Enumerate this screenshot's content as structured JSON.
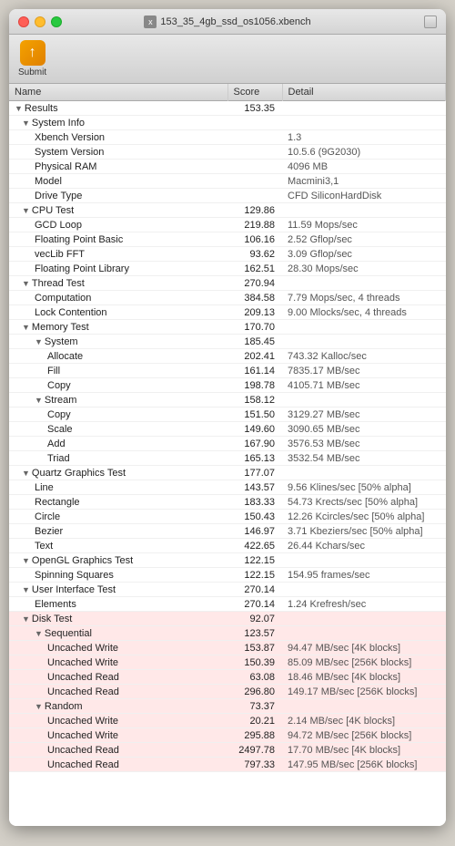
{
  "window": {
    "title": "153_35_4gb_ssd_os1056.xbench"
  },
  "toolbar": {
    "submit_label": "Submit"
  },
  "table": {
    "columns": [
      "Name",
      "Score",
      "Detail"
    ],
    "rows": [
      {
        "indent": 0,
        "toggle": true,
        "name": "Results",
        "score": "153.35",
        "detail": "",
        "highlight": false
      },
      {
        "indent": 1,
        "toggle": true,
        "name": "System Info",
        "score": "",
        "detail": "",
        "highlight": false
      },
      {
        "indent": 2,
        "toggle": false,
        "name": "Xbench Version",
        "score": "",
        "detail": "1.3",
        "highlight": false
      },
      {
        "indent": 2,
        "toggle": false,
        "name": "System Version",
        "score": "",
        "detail": "10.5.6 (9G2030)",
        "highlight": false
      },
      {
        "indent": 2,
        "toggle": false,
        "name": "Physical RAM",
        "score": "",
        "detail": "4096 MB",
        "highlight": false
      },
      {
        "indent": 2,
        "toggle": false,
        "name": "Model",
        "score": "",
        "detail": "Macmini3,1",
        "highlight": false
      },
      {
        "indent": 2,
        "toggle": false,
        "name": "Drive Type",
        "score": "",
        "detail": "CFD SiliconHardDisk",
        "highlight": false
      },
      {
        "indent": 1,
        "toggle": true,
        "name": "CPU Test",
        "score": "129.86",
        "detail": "",
        "highlight": false
      },
      {
        "indent": 2,
        "toggle": false,
        "name": "GCD Loop",
        "score": "219.88",
        "detail": "11.59 Mops/sec",
        "highlight": false
      },
      {
        "indent": 2,
        "toggle": false,
        "name": "Floating Point Basic",
        "score": "106.16",
        "detail": "2.52 Gflop/sec",
        "highlight": false
      },
      {
        "indent": 2,
        "toggle": false,
        "name": "vecLib FFT",
        "score": "93.62",
        "detail": "3.09 Gflop/sec",
        "highlight": false
      },
      {
        "indent": 2,
        "toggle": false,
        "name": "Floating Point Library",
        "score": "162.51",
        "detail": "28.30 Mops/sec",
        "highlight": false
      },
      {
        "indent": 1,
        "toggle": true,
        "name": "Thread Test",
        "score": "270.94",
        "detail": "",
        "highlight": false
      },
      {
        "indent": 2,
        "toggle": false,
        "name": "Computation",
        "score": "384.58",
        "detail": "7.79 Mops/sec, 4 threads",
        "highlight": false
      },
      {
        "indent": 2,
        "toggle": false,
        "name": "Lock Contention",
        "score": "209.13",
        "detail": "9.00 Mlocks/sec, 4 threads",
        "highlight": false
      },
      {
        "indent": 1,
        "toggle": true,
        "name": "Memory Test",
        "score": "170.70",
        "detail": "",
        "highlight": false
      },
      {
        "indent": 2,
        "toggle": true,
        "name": "System",
        "score": "185.45",
        "detail": "",
        "highlight": false
      },
      {
        "indent": 3,
        "toggle": false,
        "name": "Allocate",
        "score": "202.41",
        "detail": "743.32 Kalloc/sec",
        "highlight": false
      },
      {
        "indent": 3,
        "toggle": false,
        "name": "Fill",
        "score": "161.14",
        "detail": "7835.17 MB/sec",
        "highlight": false
      },
      {
        "indent": 3,
        "toggle": false,
        "name": "Copy",
        "score": "198.78",
        "detail": "4105.71 MB/sec",
        "highlight": false
      },
      {
        "indent": 2,
        "toggle": true,
        "name": "Stream",
        "score": "158.12",
        "detail": "",
        "highlight": false
      },
      {
        "indent": 3,
        "toggle": false,
        "name": "Copy",
        "score": "151.50",
        "detail": "3129.27 MB/sec",
        "highlight": false
      },
      {
        "indent": 3,
        "toggle": false,
        "name": "Scale",
        "score": "149.60",
        "detail": "3090.65 MB/sec",
        "highlight": false
      },
      {
        "indent": 3,
        "toggle": false,
        "name": "Add",
        "score": "167.90",
        "detail": "3576.53 MB/sec",
        "highlight": false
      },
      {
        "indent": 3,
        "toggle": false,
        "name": "Triad",
        "score": "165.13",
        "detail": "3532.54 MB/sec",
        "highlight": false
      },
      {
        "indent": 1,
        "toggle": true,
        "name": "Quartz Graphics Test",
        "score": "177.07",
        "detail": "",
        "highlight": false
      },
      {
        "indent": 2,
        "toggle": false,
        "name": "Line",
        "score": "143.57",
        "detail": "9.56 Klines/sec [50% alpha]",
        "highlight": false
      },
      {
        "indent": 2,
        "toggle": false,
        "name": "Rectangle",
        "score": "183.33",
        "detail": "54.73 Krects/sec [50% alpha]",
        "highlight": false
      },
      {
        "indent": 2,
        "toggle": false,
        "name": "Circle",
        "score": "150.43",
        "detail": "12.26 Kcircles/sec [50% alpha]",
        "highlight": false
      },
      {
        "indent": 2,
        "toggle": false,
        "name": "Bezier",
        "score": "146.97",
        "detail": "3.71 Kbeziers/sec [50% alpha]",
        "highlight": false
      },
      {
        "indent": 2,
        "toggle": false,
        "name": "Text",
        "score": "422.65",
        "detail": "26.44 Kchars/sec",
        "highlight": false
      },
      {
        "indent": 1,
        "toggle": true,
        "name": "OpenGL Graphics Test",
        "score": "122.15",
        "detail": "",
        "highlight": false
      },
      {
        "indent": 2,
        "toggle": false,
        "name": "Spinning Squares",
        "score": "122.15",
        "detail": "154.95 frames/sec",
        "highlight": false
      },
      {
        "indent": 1,
        "toggle": true,
        "name": "User Interface Test",
        "score": "270.14",
        "detail": "",
        "highlight": false
      },
      {
        "indent": 2,
        "toggle": false,
        "name": "Elements",
        "score": "270.14",
        "detail": "1.24 Krefresh/sec",
        "highlight": false
      },
      {
        "indent": 1,
        "toggle": true,
        "name": "Disk Test",
        "score": "92.07",
        "detail": "",
        "highlight": true
      },
      {
        "indent": 2,
        "toggle": true,
        "name": "Sequential",
        "score": "123.57",
        "detail": "",
        "highlight": true
      },
      {
        "indent": 3,
        "toggle": false,
        "name": "Uncached Write",
        "score": "153.87",
        "detail": "94.47 MB/sec [4K blocks]",
        "highlight": true
      },
      {
        "indent": 3,
        "toggle": false,
        "name": "Uncached Write",
        "score": "150.39",
        "detail": "85.09 MB/sec [256K blocks]",
        "highlight": true
      },
      {
        "indent": 3,
        "toggle": false,
        "name": "Uncached Read",
        "score": "63.08",
        "detail": "18.46 MB/sec [4K blocks]",
        "highlight": true
      },
      {
        "indent": 3,
        "toggle": false,
        "name": "Uncached Read",
        "score": "296.80",
        "detail": "149.17 MB/sec [256K blocks]",
        "highlight": true
      },
      {
        "indent": 2,
        "toggle": true,
        "name": "Random",
        "score": "73.37",
        "detail": "",
        "highlight": true
      },
      {
        "indent": 3,
        "toggle": false,
        "name": "Uncached Write",
        "score": "20.21",
        "detail": "2.14 MB/sec [4K blocks]",
        "highlight": true
      },
      {
        "indent": 3,
        "toggle": false,
        "name": "Uncached Write",
        "score": "295.88",
        "detail": "94.72 MB/sec [256K blocks]",
        "highlight": true
      },
      {
        "indent": 3,
        "toggle": false,
        "name": "Uncached Read",
        "score": "2497.78",
        "detail": "17.70 MB/sec [4K blocks]",
        "highlight": true
      },
      {
        "indent": 3,
        "toggle": false,
        "name": "Uncached Read",
        "score": "797.33",
        "detail": "147.95 MB/sec [256K blocks]",
        "highlight": true
      }
    ]
  }
}
